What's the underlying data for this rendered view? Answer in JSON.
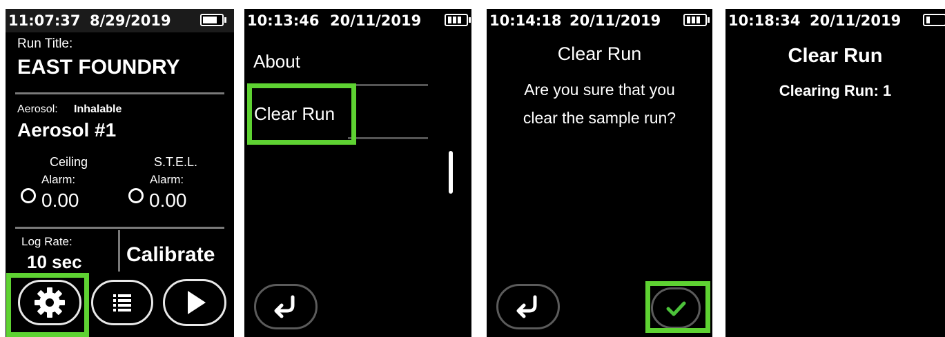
{
  "screens": [
    {
      "status": {
        "time": "11:07:37",
        "date": "8/29/2019"
      },
      "run_title_label": "Run Title:",
      "run_title": "EAST FOUNDRY",
      "aerosol_label": "Aerosol:",
      "aerosol_type": "Inhalable",
      "aerosol_name": "Aerosol #1",
      "ceiling": {
        "title": "Ceiling",
        "alarm_label": "Alarm:",
        "value": "0.00"
      },
      "stel": {
        "title": "S.T.E.L.",
        "alarm_label": "Alarm:",
        "value": "0.00"
      },
      "log_rate_label": "Log Rate:",
      "log_rate": "10 sec",
      "calibrate_label": "Calibrate",
      "bottom_buttons": [
        "gear-icon",
        "list-icon",
        "play-icon"
      ]
    },
    {
      "status": {
        "time": "10:13:46",
        "date": "20/11/2019"
      },
      "menu_items": [
        "About",
        "Clear Run"
      ]
    },
    {
      "status": {
        "time": "10:14:18",
        "date": "20/11/2019"
      },
      "title": "Clear Run",
      "message_line1": "Are you sure that you",
      "message_line2": "clear the sample run?"
    },
    {
      "status": {
        "time": "10:18:34",
        "date": "20/11/2019"
      },
      "title": "Clear Run",
      "progress_text": "Clearing Run: 1"
    }
  ],
  "highlight_color": "#5ed232",
  "confirm_color": "#4cc23a"
}
